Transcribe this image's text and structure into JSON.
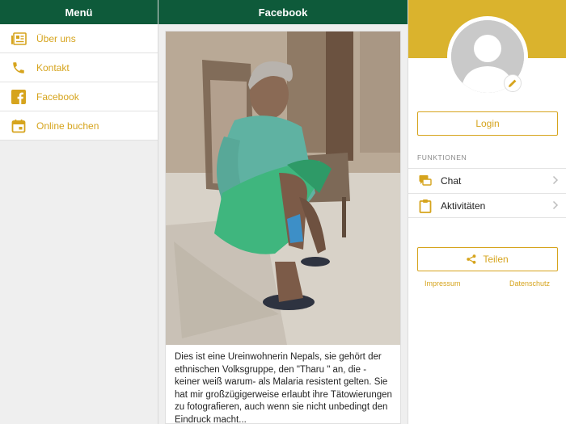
{
  "left": {
    "title": "Menü",
    "items": [
      {
        "label": "Über uns",
        "icon": "newspaper-icon"
      },
      {
        "label": "Kontakt",
        "icon": "phone-icon"
      },
      {
        "label": "Facebook",
        "icon": "facebook-icon"
      },
      {
        "label": "Online buchen",
        "icon": "calendar-icon"
      }
    ]
  },
  "mid": {
    "title": "Facebook",
    "post": {
      "text": "Dies ist eine Ureinwohnerin Nepals, sie gehört der ethnischen Volksgruppe, den \"Tharu \" an, die - keiner weiß warum- als Malaria resistent gelten. Sie hat mir großzügigerweise erlaubt ihre Tätowierungen zu fotografieren, auch wenn sie nicht unbedingt den Eindruck macht..."
    }
  },
  "right": {
    "login_label": "Login",
    "section_title": "FUNKTIONEN",
    "functions": [
      {
        "label": "Chat",
        "icon": "chat-icon"
      },
      {
        "label": "Aktivitäten",
        "icon": "clipboard-icon"
      }
    ],
    "share_label": "Teilen",
    "impressum": "Impressum",
    "datenschutz": "Datenschutz"
  },
  "colors": {
    "header_green": "#0e5a3a",
    "accent_gold": "#d6a41d",
    "profile_gold": "#dab32d"
  }
}
